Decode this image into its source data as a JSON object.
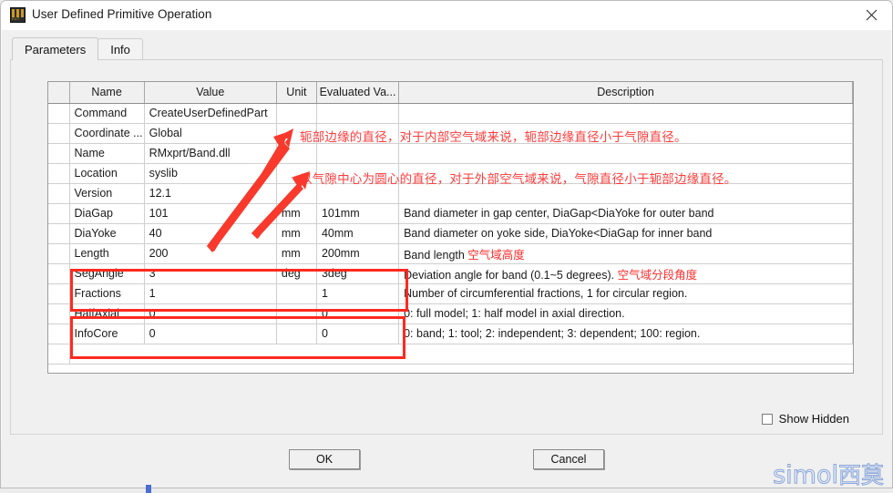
{
  "window": {
    "title": "User Defined Primitive Operation",
    "icon": "edt-icon",
    "close_label": "close-icon"
  },
  "tabs": [
    {
      "label": "Parameters",
      "active": true
    },
    {
      "label": "Info",
      "active": false
    }
  ],
  "grid": {
    "headers": [
      "",
      "Name",
      "Value",
      "Unit",
      "Evaluated Va...",
      "Description"
    ],
    "rows": [
      {
        "name": "Command",
        "value": "CreateUserDefinedPart",
        "unit": "",
        "evaluated": "",
        "desc": "",
        "desc_cn": "",
        "highlight": false
      },
      {
        "name": "Coordinate ...",
        "value": "Global",
        "unit": "",
        "evaluated": "",
        "desc": "",
        "desc_cn": "",
        "highlight": false
      },
      {
        "name": "Name",
        "value": "RMxprt/Band.dll",
        "unit": "",
        "evaluated": "",
        "desc": "",
        "desc_cn": "",
        "highlight": false
      },
      {
        "name": "Location",
        "value": "syslib",
        "unit": "",
        "evaluated": "",
        "desc": "",
        "desc_cn": "",
        "highlight": false
      },
      {
        "name": "Version",
        "value": "12.1",
        "unit": "",
        "evaluated": "",
        "desc": "",
        "desc_cn": "",
        "highlight": false
      },
      {
        "name": "DiaGap",
        "value": "101",
        "unit": "mm",
        "evaluated": "101mm",
        "desc": "Band diameter in gap center, DiaGap<DiaYoke for outer band",
        "desc_cn": "",
        "highlight": true
      },
      {
        "name": "DiaYoke",
        "value": "40",
        "unit": "mm",
        "evaluated": "40mm",
        "desc": "Band diameter on yoke side, DiaYoke<DiaGap for inner band",
        "desc_cn": "",
        "highlight": true
      },
      {
        "name": "Length",
        "value": "200",
        "unit": "mm",
        "evaluated": "200mm",
        "desc": "Band length ",
        "desc_cn": "空气域高度",
        "highlight": true
      },
      {
        "name": "SegAngle",
        "value": "3",
        "unit": "deg",
        "evaluated": "3deg",
        "desc": "Deviation angle for band (0.1~5 degrees). ",
        "desc_cn": "空气域分段角度",
        "highlight": true
      },
      {
        "name": "Fractions",
        "value": "1",
        "unit": "",
        "evaluated": "1",
        "desc": "Number of circumferential fractions, 1 for circular region.",
        "desc_cn": "",
        "highlight": false
      },
      {
        "name": "HalfAxial",
        "value": "0",
        "unit": "",
        "evaluated": "0",
        "desc": "0: full model; 1: half model in axial direction.",
        "desc_cn": "",
        "highlight": false
      },
      {
        "name": "InfoCore",
        "value": "0",
        "unit": "",
        "evaluated": "0",
        "desc": "0: band; 1: tool; 2: independent; 3: dependent; 100: region.",
        "desc_cn": "",
        "highlight": false
      }
    ]
  },
  "annotations": [
    {
      "text": "轭部边缘的直径，对于内部空气域来说，轭部边缘直径小于气隙直径。"
    },
    {
      "text": "以气隙中心为圆心的直径，对于外部空气域来说，气隙直径小于轭部边缘直径。"
    }
  ],
  "options": {
    "show_hidden_label": "Show Hidden",
    "show_hidden_checked": false
  },
  "footer": {
    "ok_label": "OK",
    "cancel_label": "Cancel"
  },
  "watermark": {
    "latin": "simol",
    "cjk": "西莫"
  },
  "colors": {
    "annotation_red": "#ff3b3b",
    "highlight_red": "#ff2a1f",
    "window_bg": "#f0f0f0",
    "grid_bg": "#ffffff",
    "watermark_blue": "#8aa6d8"
  }
}
